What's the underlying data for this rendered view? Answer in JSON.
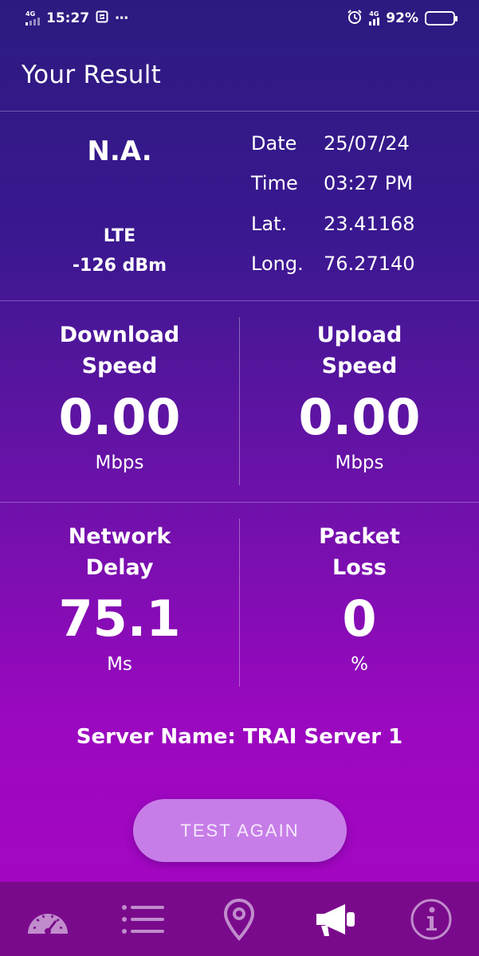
{
  "status_bar": {
    "network_tag_left": "4G",
    "time": "15:27",
    "extra": "⋯",
    "network_tag_right": "4G",
    "battery": "92%",
    "battery_level": 0.92
  },
  "header": {
    "title": "Your Result"
  },
  "info": {
    "operator": "N.A.",
    "technology": "LTE",
    "signal": "-126 dBm",
    "rows": [
      {
        "key": "Date",
        "value": "25/07/24"
      },
      {
        "key": "Time",
        "value": "03:27 PM"
      },
      {
        "key": "Lat.",
        "value": "23.41168"
      },
      {
        "key": "Long.",
        "value": "76.27140"
      }
    ]
  },
  "metrics": {
    "download": {
      "label_1": "Download",
      "label_2": "Speed",
      "value": "0.00",
      "unit": "Mbps"
    },
    "upload": {
      "label_1": "Upload",
      "label_2": "Speed",
      "value": "0.00",
      "unit": "Mbps"
    },
    "delay": {
      "label_1": "Network",
      "label_2": "Delay",
      "value": "75.1",
      "unit": "Ms"
    },
    "loss": {
      "label_1": "Packet",
      "label_2": "Loss",
      "value": "0",
      "unit": "%"
    }
  },
  "server": {
    "text": "Server Name: TRAI Server 1"
  },
  "actions": {
    "test_again": "TEST AGAIN"
  },
  "nav": {
    "items": [
      {
        "icon": "speedometer-icon"
      },
      {
        "icon": "list-icon"
      },
      {
        "icon": "location-pin-icon"
      },
      {
        "icon": "megaphone-icon"
      },
      {
        "icon": "info-icon"
      }
    ]
  },
  "colors": {
    "nav_active": "#ffffff",
    "nav_inactive": "#c08ccc",
    "button": "#c77de8",
    "nav_bg": "#7a0a8c"
  }
}
